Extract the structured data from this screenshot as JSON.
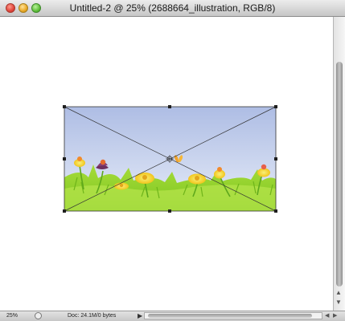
{
  "window": {
    "title": "Untitled-2 @ 25% (2688664_illustration, RGB/8)",
    "buttons": [
      "close",
      "minimize",
      "zoom"
    ]
  },
  "status": {
    "zoom": "25%",
    "doc_info": "Doc: 24.1M/0 bytes"
  },
  "icons": {
    "play": "▶",
    "scroll_up": "▲",
    "scroll_down": "▼",
    "scroll_left": "◀",
    "scroll_right": "▶"
  },
  "colors": {
    "sky_top": "#b3c2e6",
    "sky_bottom": "#dfe7f7",
    "grass": "#8fd12b",
    "flower_yellow": "#f6d932",
    "flower_purple": "#6e2f5e"
  }
}
